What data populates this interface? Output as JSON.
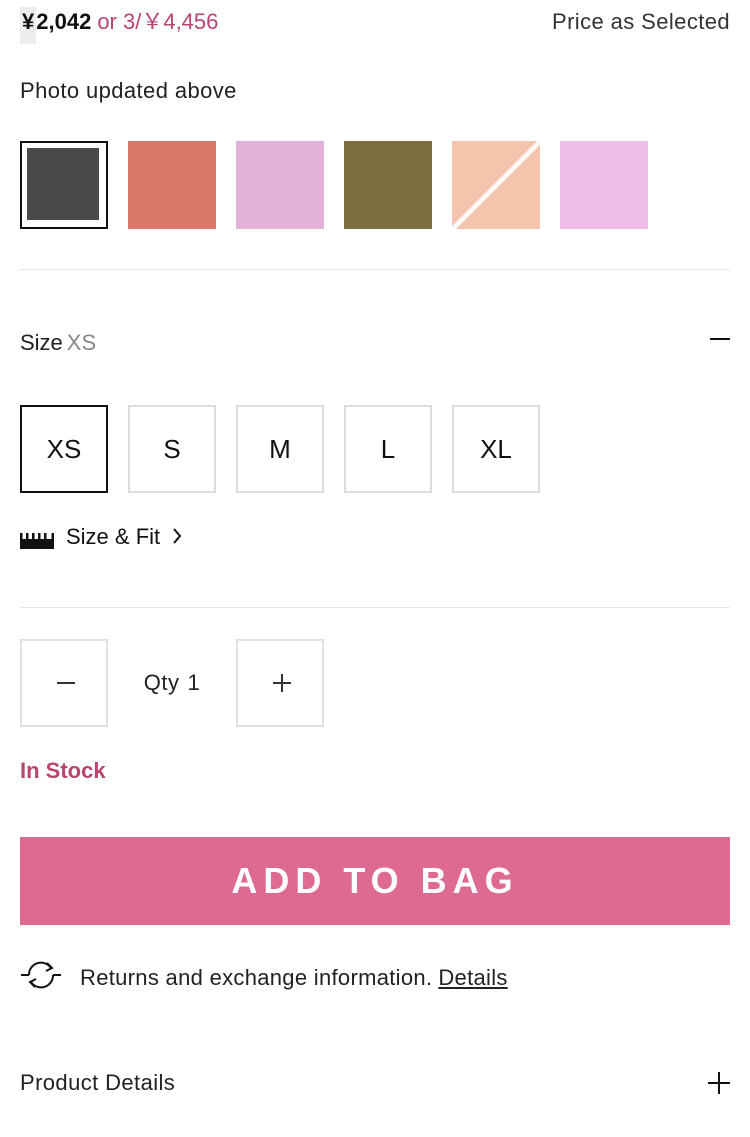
{
  "price": {
    "currency": "¥",
    "amount": "2,042",
    "multi_buy": "or 3/￥4,456",
    "note": "Price as Selected"
  },
  "photo_note": "Photo updated above",
  "swatches": [
    {
      "color": "#4a4a4a",
      "selected": true
    },
    {
      "color": "#d9786a",
      "selected": false
    },
    {
      "color": "#e3b2d6",
      "selected": false
    },
    {
      "color": "#7b6f3f",
      "selected": false
    },
    {
      "color": "#f6c3ad",
      "selected": false,
      "unavailable": true
    },
    {
      "color": "#f0bde6",
      "selected": false
    }
  ],
  "size": {
    "label": "Size",
    "selected": "XS",
    "options": [
      "XS",
      "S",
      "M",
      "L",
      "XL"
    ],
    "fit_link": "Size & Fit",
    "fit_icon": "ruler-icon"
  },
  "quantity": {
    "label": "Qty",
    "value": "1",
    "minus_icon": "minus-icon",
    "plus_icon": "plus-icon"
  },
  "stock_status": "In Stock",
  "add_to_bag": "ADD TO BAG",
  "returns": {
    "text": "Returns and exchange information.",
    "link": "Details",
    "icon": "exchange-icon"
  },
  "product_details": {
    "title": "Product Details",
    "icon": "plus-icon"
  },
  "colors": {
    "accent": "#de6a94",
    "stock": "#b8446f"
  }
}
